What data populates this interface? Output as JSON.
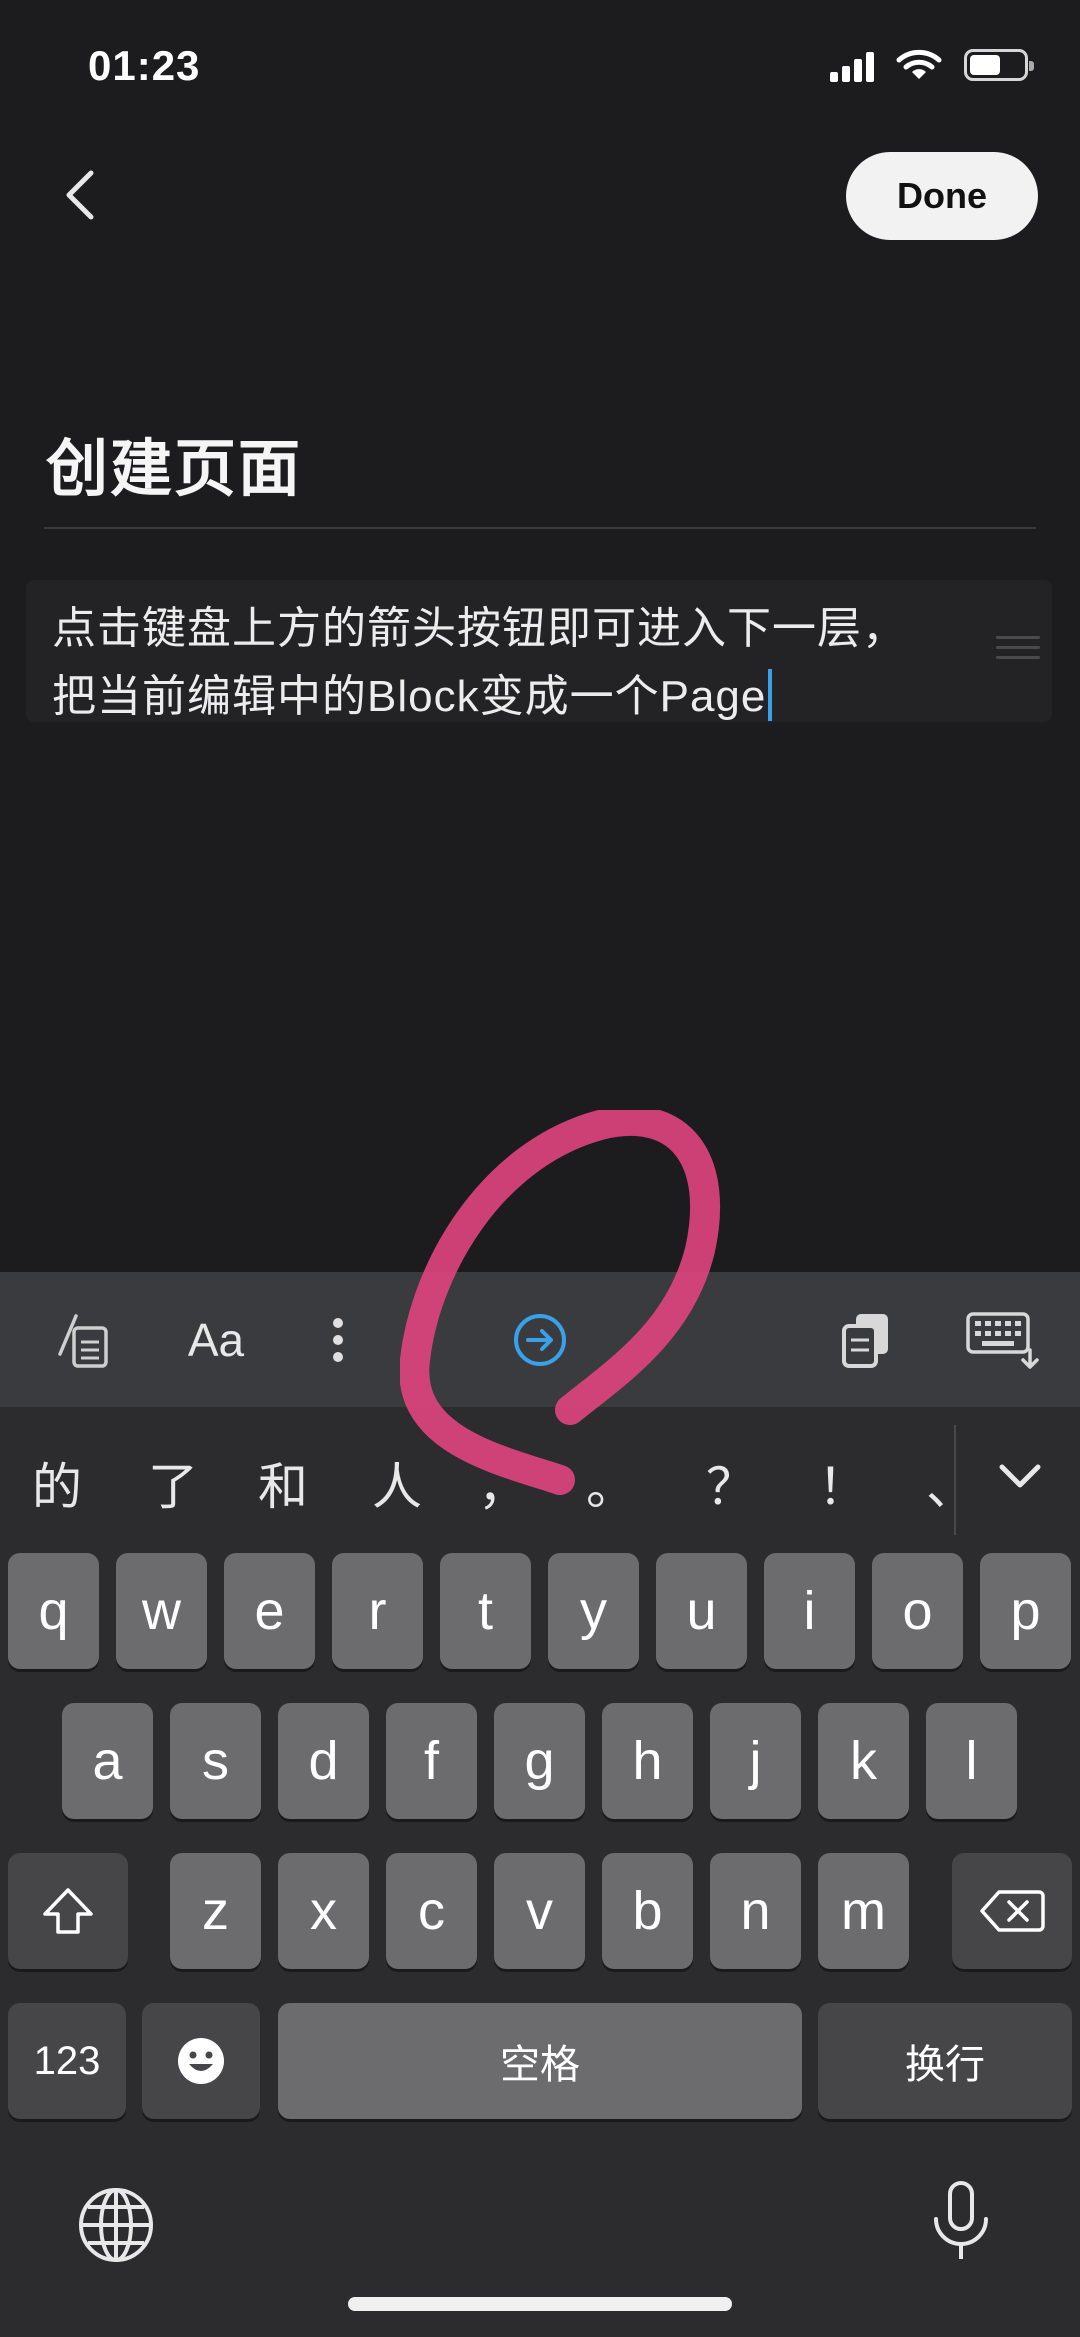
{
  "status_bar": {
    "time": "01:23",
    "signal_icon": "cellular-signal-icon",
    "wifi_icon": "wifi-icon",
    "battery_icon": "battery-icon"
  },
  "nav": {
    "back_icon": "chevron-left-icon",
    "done_label": "Done"
  },
  "page": {
    "title": "创建页面",
    "block_line1": "点击键盘上方的箭头按钮即可进入下一层，",
    "block_line2": "把当前编辑中的Block变成一个Page"
  },
  "toolbar": {
    "turn_into_icon": "turn-into-icon",
    "text_style_label": "Aa",
    "more_icon": "more-vertical-icon",
    "indent_icon": "arrow-circle-right-icon",
    "accent_color": "#3aa0e8",
    "clipboard_icon": "clipboard-icon",
    "dismiss_keyboard_icon": "keyboard-dismiss-icon"
  },
  "candidates": [
    "的",
    "了",
    "和",
    "人",
    "，",
    "。",
    "？",
    "！",
    "、"
  ],
  "keyboard": {
    "row1": [
      "q",
      "w",
      "e",
      "r",
      "t",
      "y",
      "u",
      "i",
      "o",
      "p"
    ],
    "row2": [
      "a",
      "s",
      "d",
      "f",
      "g",
      "h",
      "j",
      "k",
      "l"
    ],
    "row3": [
      "z",
      "x",
      "c",
      "v",
      "b",
      "n",
      "m"
    ],
    "numbers_label": "123",
    "space_label": "空格",
    "return_label": "换行",
    "shift_icon": "shift-icon",
    "delete_icon": "backspace-icon",
    "emoji_icon": "emoji-icon",
    "globe_icon": "globe-icon",
    "mic_icon": "microphone-icon"
  },
  "annotation": {
    "color": "#e0457f"
  }
}
